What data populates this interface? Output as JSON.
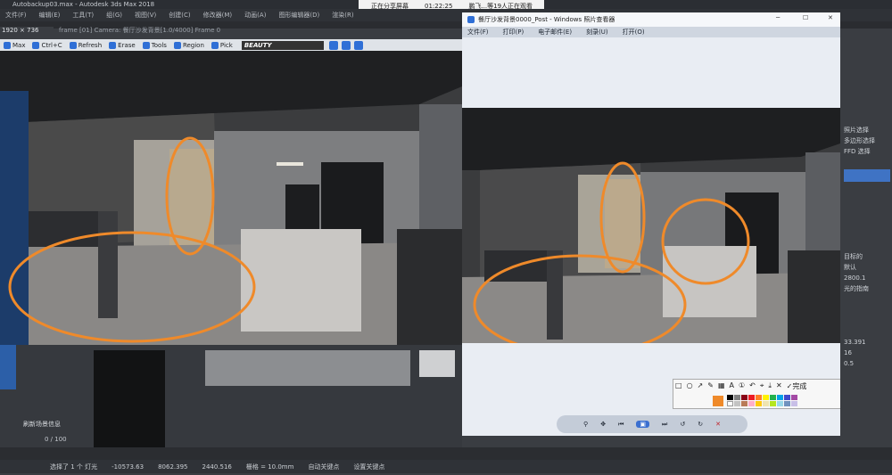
{
  "titlebar": {
    "file": "Autobackup03.max - Autodesk 3ds Max 2018",
    "share_status": "正在分享屏幕",
    "share_time": "01:22:25",
    "viewers": "鹏飞...等19人正在观看"
  },
  "menubar": {
    "items": [
      "文件(F)",
      "编辑(E)",
      "工具(T)",
      "组(G)",
      "视图(V)",
      "创建(C)",
      "修改器(M)",
      "动画(A)",
      "图形编辑器(D)",
      "渲染(R)"
    ]
  },
  "vfb": {
    "resolution": "1920 × 736",
    "title": "frame [01] Camera: 餐厅沙发背景[1.0/4000] Frame 0",
    "toolbar": {
      "max_label": "Max",
      "ctrlc_label": "Ctrl+C",
      "refresh_label": "Refresh",
      "erase_label": "Erase",
      "tools_label": "Tools",
      "region_label": "Region",
      "pick_label": "Pick",
      "channel": "BEAUTY"
    }
  },
  "photo_viewer": {
    "title": "餐厅沙发背景0000_Post - Windows 照片查看器",
    "menu": [
      "文件(F)",
      "打印(P)",
      "电子邮件(E)",
      "刻录(U)",
      "打开(O)"
    ]
  },
  "right_panel": {
    "labels": [
      "照片选择",
      "多边形选择",
      "FFD 选择",
      "目标的",
      "默认",
      "2800.1",
      "光的指南",
      "33.391",
      "16",
      "0.5"
    ]
  },
  "annotation_toolbar": {
    "done_label": "完成",
    "colors": [
      "#000000",
      "#7f7f7f",
      "#880015",
      "#ed1c24",
      "#ff7f27",
      "#fff200",
      "#22b14c",
      "#00a2e8",
      "#3f48cc",
      "#a349a4",
      "#ffffff",
      "#c3c3c3",
      "#b97a57",
      "#ffaec9",
      "#ffc90e",
      "#efe4b0",
      "#b5e61d",
      "#99d9ea",
      "#7092be",
      "#c8bfe7"
    ],
    "selected_color": "#ef8a2a"
  },
  "bottom_panel": {
    "scene_info": "刷新场景信息",
    "frame_counter": "0 / 100"
  },
  "statusbar": {
    "selection": "选择了 1 个 灯光",
    "values": [
      "-10573.63",
      "8062.395",
      "2440.516",
      "栅格 = 10.0mm"
    ],
    "auto": "自动关键点",
    "set_key": "设置关键点"
  },
  "accent": "#ef8a2a"
}
